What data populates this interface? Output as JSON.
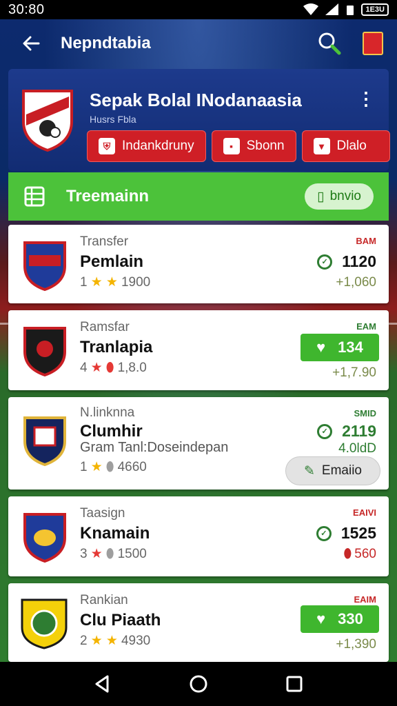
{
  "status": {
    "time": "30:80",
    "battery": "1E3U"
  },
  "appbar": {
    "title": "Nepndtabia"
  },
  "hero": {
    "title": "Sepak Bolal INodanaasia",
    "subtitle": "Husrs  Fbla",
    "buttons": [
      {
        "label": "Indankdruny",
        "icon": "shield-icon"
      },
      {
        "label": "Sbonn",
        "icon": "message-icon"
      },
      {
        "label": "Dlalo",
        "icon": "cup-icon"
      }
    ]
  },
  "section": {
    "label": "Treemainn",
    "action_label": "bnvio"
  },
  "cards": [
    {
      "category": "Transfer",
      "name": "Pemlain",
      "rating_num": "1",
      "rating_value": "1900",
      "tag": "BAM",
      "score": "1120",
      "sub": "+1,060"
    },
    {
      "category": "Ramsfar",
      "name": "Tranlapia",
      "rating_num": "4",
      "rating_value": "1,8.0",
      "tag": "EAM",
      "score": "134",
      "sub": "+1,7.90"
    },
    {
      "category": "N.linknna",
      "name": "Clumhir",
      "description": "Gram  Tanl:Doseindepan",
      "rating_num": "1",
      "rating_value": "4660",
      "tag": "SMID",
      "score": "2119",
      "sub": "4.0ldD",
      "action_label": "Emaiio"
    },
    {
      "category": "Taasign",
      "name": "Knamain",
      "rating_num": "3",
      "rating_value": "1500",
      "tag": "EAIVI",
      "score": "1525",
      "sub": "560"
    },
    {
      "category": "Rankian",
      "name": "Clu Piaath",
      "rating_num": "2",
      "rating_value": "4930",
      "tag": "EAIM",
      "score": "330",
      "sub": "+1,390"
    }
  ],
  "colors": {
    "accent_red": "#cf1f26",
    "accent_green": "#4cc23a",
    "navy": "#122c73"
  }
}
